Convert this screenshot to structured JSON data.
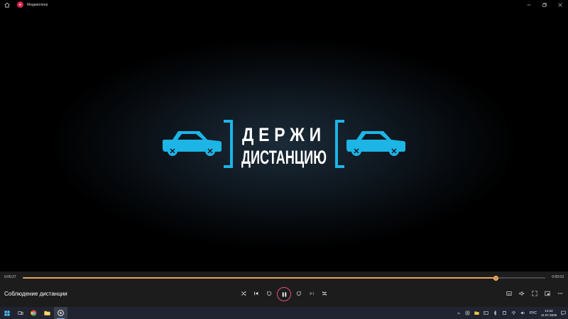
{
  "window": {
    "title": "Медиаплеер"
  },
  "video": {
    "logo_line1": "ДЕРЖИ",
    "logo_line2": "ДИСТАНЦИЮ",
    "accent": "#1db4e6"
  },
  "player": {
    "current_time": "0:00:27",
    "total_time": "0:00:03",
    "progress": 0.906,
    "media_title": "Соблюдение дистанции",
    "accent": "#e74e7e"
  },
  "taskbar": {
    "apps": [
      "windows-start-icon",
      "search-icon",
      "task-view-icon",
      "chrome-icon",
      "file-explorer-icon",
      "media-player-icon"
    ],
    "language": "РУС",
    "time": "14:22",
    "date": "11.07.2025"
  }
}
